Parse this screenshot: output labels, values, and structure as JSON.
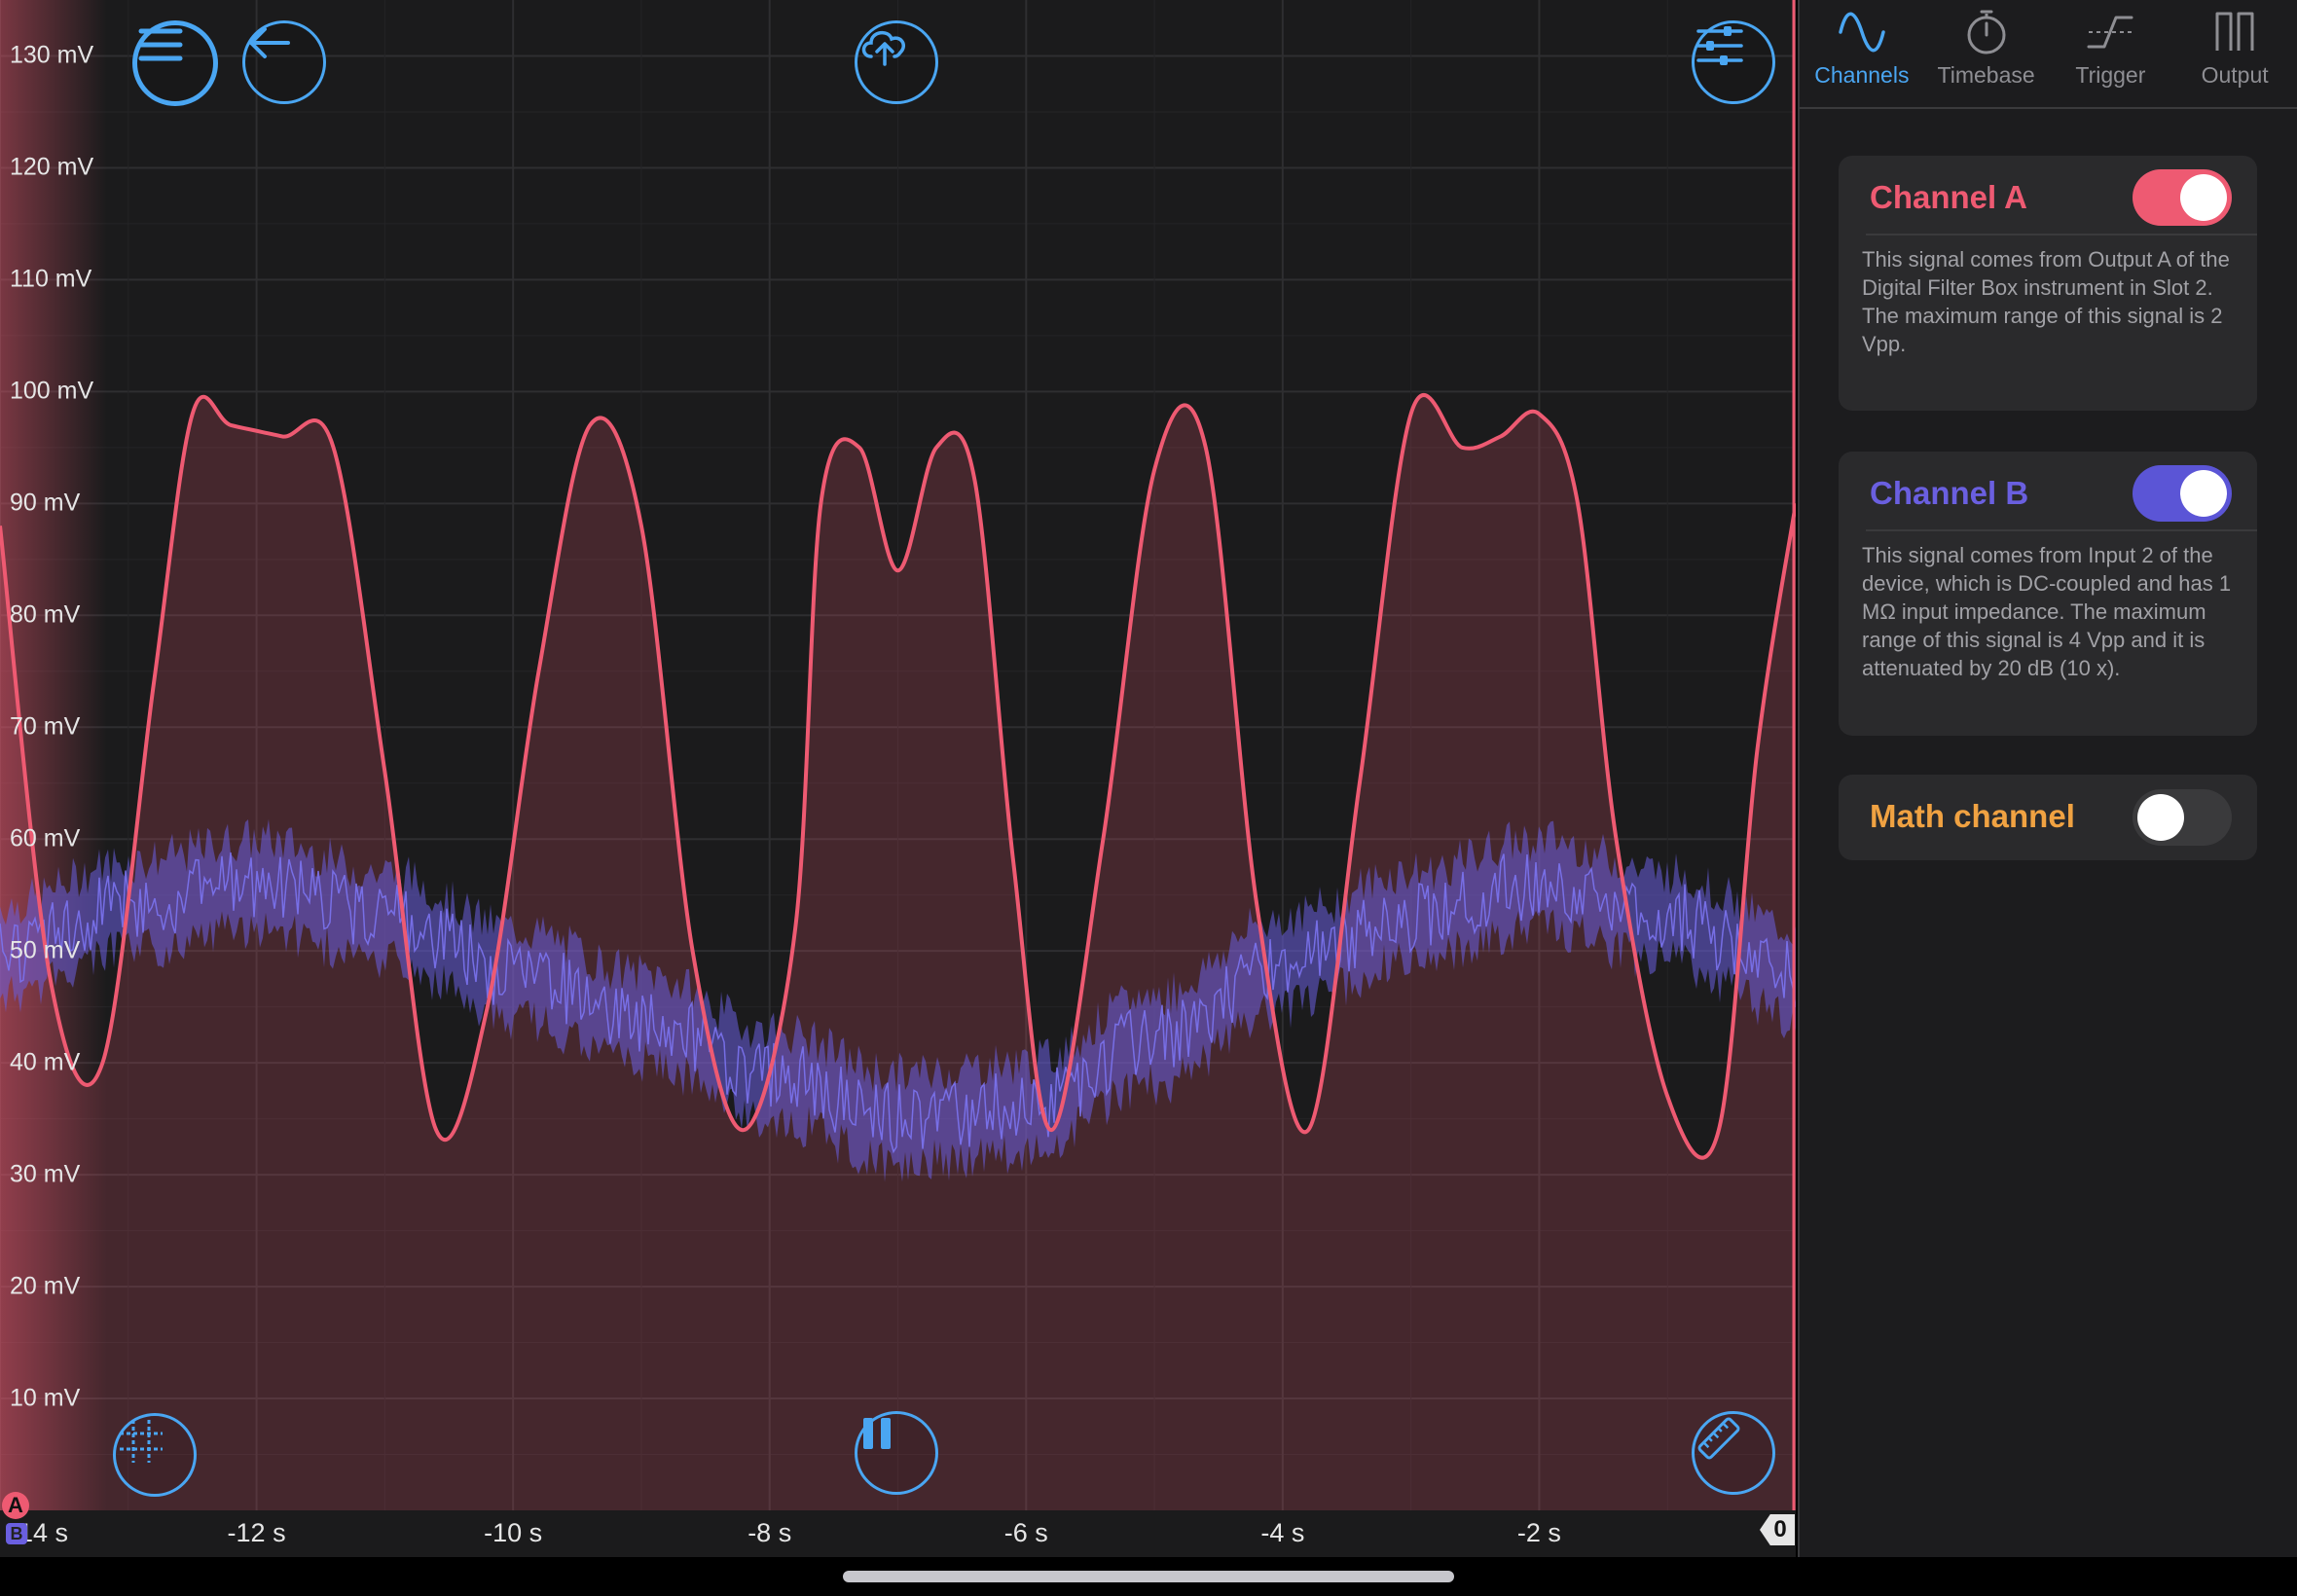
{
  "colors": {
    "channel_a": "#ee5a72",
    "channel_b": "#6a5fe0",
    "math": "#f0a242",
    "accent": "#4aa6f2"
  },
  "toolbar": {
    "menu_icon": "hamburger-menu-icon",
    "back_icon": "arrow-left-icon",
    "upload_icon": "cloud-upload-icon",
    "settings_icon": "sliders-icon",
    "grid_icon": "crosshair-grid-icon",
    "pause_icon": "pause-icon",
    "measure_icon": "ruler-icon"
  },
  "markers": {
    "channel_a": "A",
    "channel_b": "B",
    "trigger": "0"
  },
  "panel": {
    "tabs": [
      {
        "label": "Channels",
        "icon": "sine-wave-icon",
        "active": true
      },
      {
        "label": "Timebase",
        "icon": "stopwatch-icon",
        "active": false
      },
      {
        "label": "Trigger",
        "icon": "trigger-edge-icon",
        "active": false
      },
      {
        "label": "Output",
        "icon": "square-pulse-icon",
        "active": false
      }
    ],
    "channel_a": {
      "title": "Channel A",
      "enabled": true,
      "description": "This signal comes from Output A of the Digital Filter Box instrument in Slot 2. The maximum range of this signal is 2 Vpp."
    },
    "channel_b": {
      "title": "Channel B",
      "enabled": true,
      "description": "This signal comes from Input 2 of the device, which is DC-coupled and has 1 MΩ input impedance. The maximum range of this signal is 4 Vpp and it is attenuated by 20 dB (10 x)."
    },
    "math_channel": {
      "title": "Math channel",
      "enabled": false
    }
  },
  "chart_data": {
    "type": "line",
    "y_ticks": [
      "130 mV",
      "120 mV",
      "110 mV",
      "100 mV",
      "90 mV",
      "80 mV",
      "70 mV",
      "60 mV",
      "50 mV",
      "40 mV",
      "30 mV",
      "20 mV",
      "10 mV"
    ],
    "x_ticks": [
      "-14 s",
      "-12 s",
      "-10 s",
      "-8 s",
      "-6 s",
      "-4 s",
      "-2 s"
    ],
    "xlim": [
      -14,
      0
    ],
    "ylim": [
      0,
      135
    ],
    "grid": true,
    "series": [
      {
        "name": "Channel A",
        "x": [
          -14,
          -13.6,
          -13.2,
          -12.8,
          -12.5,
          -12.2,
          -11.8,
          -11.4,
          -11,
          -10.6,
          -10.2,
          -9.8,
          -9.4,
          -9,
          -8.6,
          -8.2,
          -7.8,
          -7.6,
          -7.3,
          -7,
          -6.7,
          -6.4,
          -6.1,
          -5.8,
          -5.4,
          -5,
          -4.6,
          -4.2,
          -3.8,
          -3.4,
          -3,
          -2.6,
          -2.3,
          -2,
          -1.7,
          -1.4,
          -1,
          -0.6,
          -0.3,
          0
        ],
        "y": [
          88,
          47,
          40,
          74,
          98,
          97,
          96,
          95,
          66,
          34,
          45,
          75,
          97,
          88,
          50,
          34,
          52,
          90,
          95,
          84,
          95,
          92,
          58,
          34,
          60,
          93,
          95,
          54,
          34,
          65,
          98,
          95,
          96,
          98,
          90,
          60,
          37,
          34,
          68,
          90
        ]
      },
      {
        "name": "Channel B",
        "x": [
          -14,
          -13,
          -12,
          -11,
          -10,
          -9,
          -8,
          -7,
          -6,
          -5,
          -4,
          -3,
          -2,
          -1,
          0
        ],
        "y": [
          50,
          54,
          56,
          53,
          48,
          44,
          39,
          35,
          36,
          42,
          49,
          53,
          56,
          53,
          48
        ],
        "noise_amplitude": 4
      }
    ]
  }
}
